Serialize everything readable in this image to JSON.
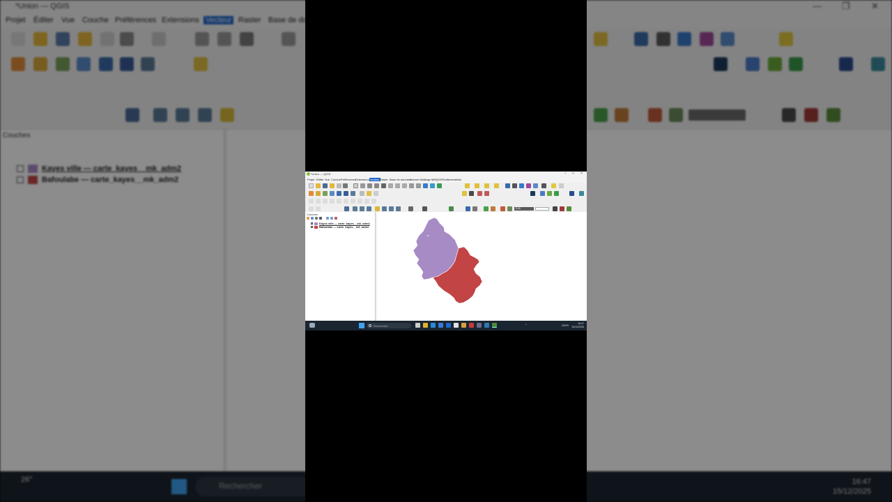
{
  "window": {
    "title": "*Union — QGIS",
    "bg_title": "*Union — QGIS"
  },
  "menu": {
    "items": [
      "Projet",
      "Éditer",
      "Vue",
      "Couche",
      "Préférences",
      "Extensions",
      "Vecteur",
      "Raster",
      "Base de données",
      "Internet",
      "Maillage",
      "MMQGIS",
      "Traitement",
      "Aide"
    ],
    "bg_items": [
      "Projet",
      "Éditer",
      "Vue",
      "Couche",
      "Préférences",
      "Extensions",
      "Vecteur",
      "Raster",
      "Base de do"
    ],
    "active": "Vecteur"
  },
  "toolbar": {
    "scale_value": "8,68"
  },
  "layers_panel": {
    "title": "Couches",
    "layers": [
      {
        "label": "Kayes ville — carte_kayes__mk_adm2",
        "color": "#a78bc4",
        "checked": true
      },
      {
        "label": "Bafoulabe — carte_kayes__mk_adm2",
        "color": "#c24444",
        "checked": true
      }
    ]
  },
  "map": {
    "polygons": [
      {
        "name": "Kayes ville",
        "color": "#a78bc4"
      },
      {
        "name": "Bafoulabe",
        "color": "#c24444"
      }
    ]
  },
  "taskbar": {
    "search_placeholder": "Rechercher",
    "weather_temp": "26°",
    "battery": "100%",
    "time": "16:47",
    "date": "15/12/2025"
  },
  "colors": {
    "accent": "#1e64c8",
    "taskbar": "#1b2531",
    "kayes": "#a78bc4",
    "bafoulabe": "#c24444"
  }
}
